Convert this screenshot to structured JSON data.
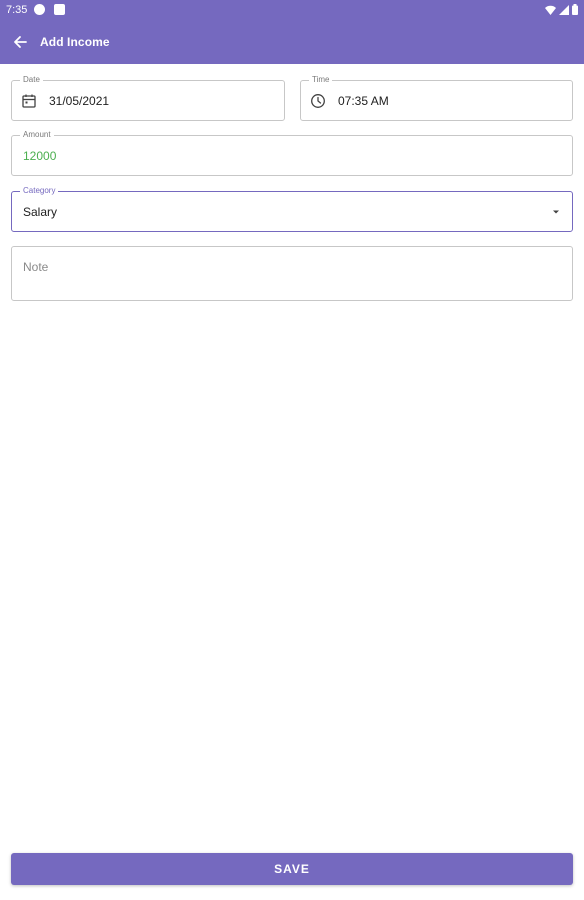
{
  "status_bar": {
    "time": "7:35"
  },
  "app_bar": {
    "title": "Add Income"
  },
  "form": {
    "date": {
      "label": "Date",
      "value": "31/05/2021",
      "icon": "calendar-icon"
    },
    "time": {
      "label": "Time",
      "value": "07:35 AM",
      "icon": "clock-icon"
    },
    "amount": {
      "label": "Amount",
      "value": "12000",
      "value_color": "#4caf50"
    },
    "category": {
      "label": "Category",
      "value": "Salary",
      "icon": "dropdown-arrow-icon"
    },
    "note": {
      "placeholder": "Note",
      "value": ""
    }
  },
  "actions": {
    "save_label": "SAVE"
  },
  "colors": {
    "primary": "#7569bf",
    "amount_green": "#4caf50",
    "border": "#c7c7c7"
  }
}
